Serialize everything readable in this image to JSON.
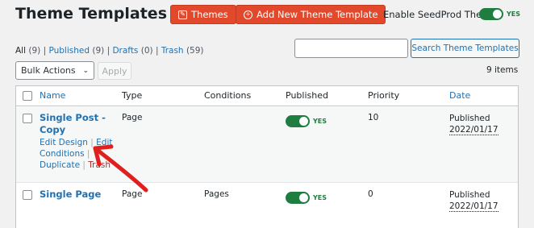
{
  "header": {
    "title": "Theme Templates",
    "help_icon": "?",
    "themes_button": "Themes",
    "add_button": "Add New Theme Template",
    "enable_label": "Enable SeedProd Theme",
    "enable_toggle_text": "YES"
  },
  "filters": {
    "all": "All",
    "all_count": "(9)",
    "published": "Published",
    "published_count": "(9)",
    "drafts": "Drafts",
    "drafts_count": "(0)",
    "trash": "Trash",
    "trash_count": "(59)"
  },
  "search": {
    "button": "Search Theme Templates",
    "placeholder": ""
  },
  "bulk": {
    "selected": "Bulk Actions",
    "apply": "Apply",
    "items_count": "9 items"
  },
  "columns": {
    "name": "Name",
    "type": "Type",
    "conditions": "Conditions",
    "published": "Published",
    "priority": "Priority",
    "date": "Date"
  },
  "rows": [
    {
      "title_line1": "Single Post -",
      "title_line2": "Copy",
      "type": "Page",
      "conditions": "",
      "published": "YES",
      "priority": "10",
      "date_status": "Published",
      "date": "2022/01/17",
      "actions": {
        "edit_design": "Edit Design",
        "edit_conditions_1": "Edit",
        "edit_conditions_2": "Conditions",
        "duplicate": "Duplicate",
        "trash": "Trash"
      }
    },
    {
      "title": "Single Page",
      "type": "Page",
      "conditions": "Pages",
      "published": "YES",
      "priority": "0",
      "date_status": "Published",
      "date": "2022/01/17"
    }
  ],
  "colors": {
    "accent": "#e2492c",
    "link": "#2271b1",
    "toggle_on": "#1e7d3f",
    "annotation": "#e0201f"
  }
}
